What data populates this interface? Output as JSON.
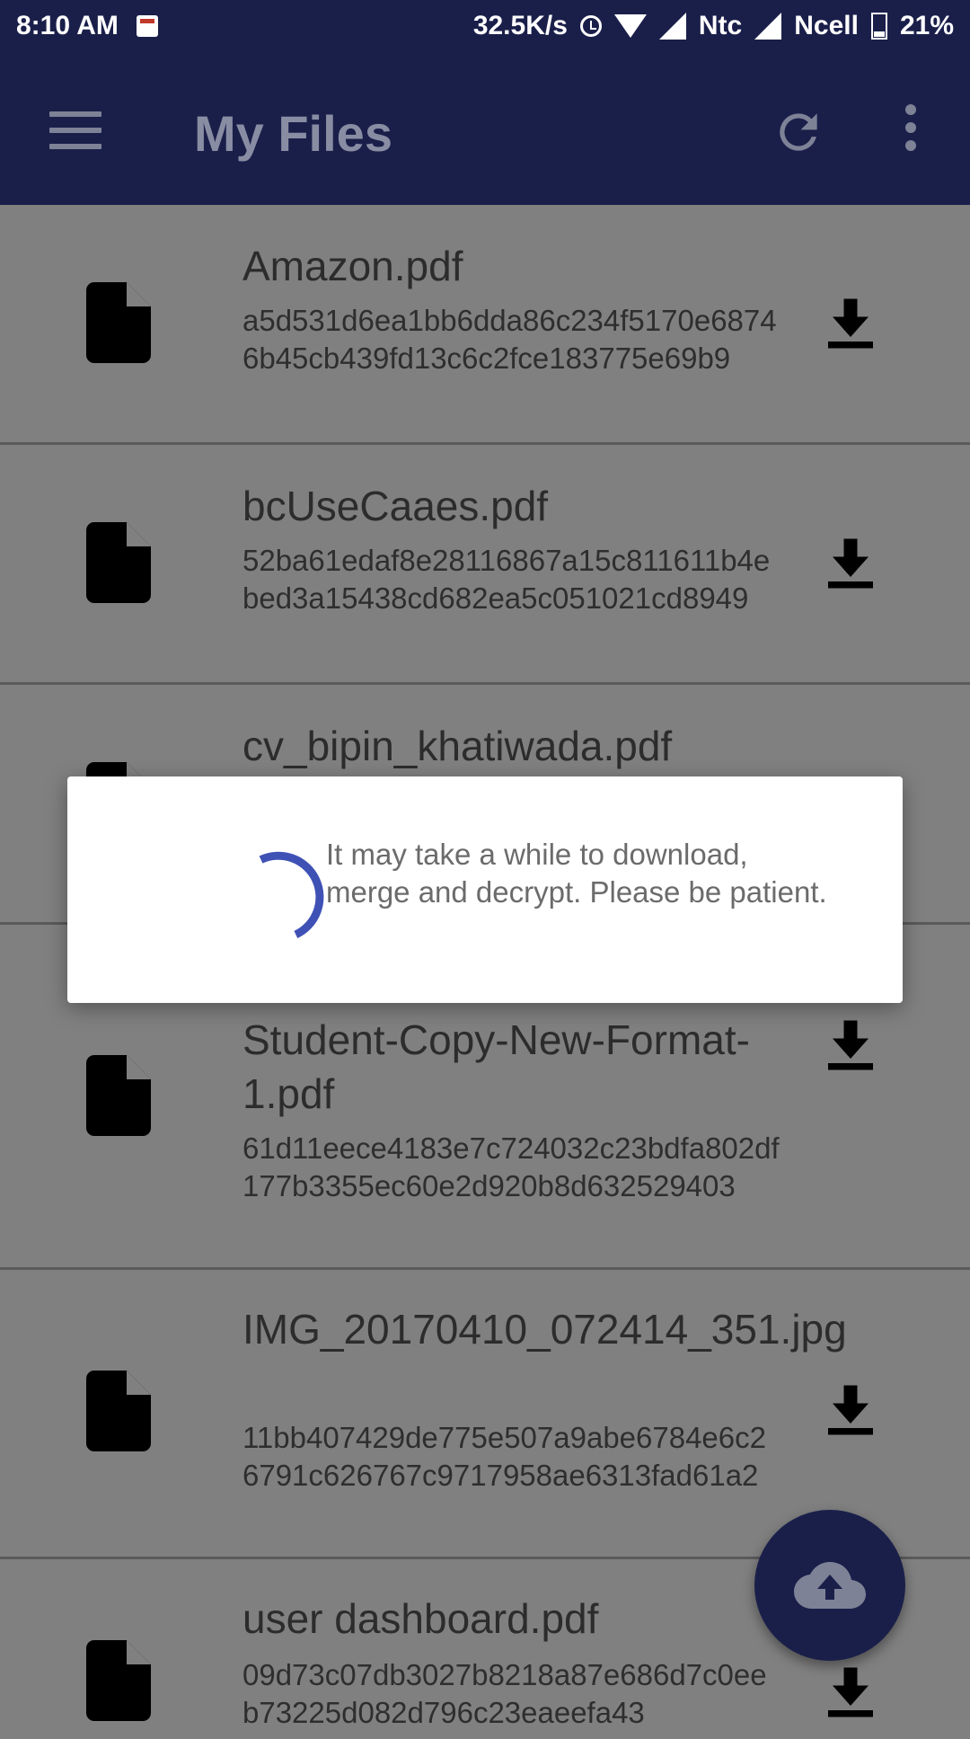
{
  "status_bar": {
    "time": "8:10 AM",
    "speed": "32.5K/s",
    "carrier1": "Ntc",
    "carrier2": "Ncell",
    "battery": "21%"
  },
  "app_bar": {
    "title": "My Files",
    "icons": [
      "menu-icon",
      "refresh-icon",
      "more-vert-icon"
    ]
  },
  "files": [
    {
      "name": "Amazon.pdf",
      "hash": "a5d531d6ea1bb6dda86c234f5170e68746b45cb439fd13c6c2fce183775e69b9"
    },
    {
      "name": "bcUseCaaes.pdf",
      "hash": "52ba61edaf8e28116867a15c811611b4ebed3a15438cd682ea5c051021cd8949"
    },
    {
      "name": "cv_bipin_khatiwada.pdf",
      "hash": ""
    },
    {
      "name": "Student-Copy-New-Format-1.pdf",
      "hash": "61d11eece4183e7c724032c23bdfa802df177b3355ec60e2d920b8d632529403"
    },
    {
      "name": "IMG_20170410_072414_351.jpg",
      "hash": "11bb407429de775e507a9abe6784e6c26791c626767c9717958ae6313fad61a2"
    },
    {
      "name": "user dashboard.pdf",
      "hash": "09d73c07db3027b8218a87e686d7c0eeb73225d082d796c23eaeefa43"
    }
  ],
  "dialog": {
    "message": "It may take a while to download, merge and decrypt. Please be patient."
  },
  "fab": {
    "icon": "cloud-upload-icon"
  },
  "colors": {
    "primary": "#1a1f4a",
    "spinner": "#3f51b5"
  }
}
